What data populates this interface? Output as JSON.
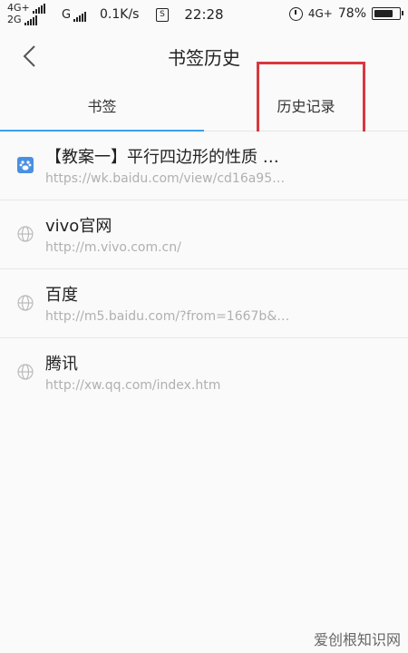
{
  "status_bar": {
    "net1": "4G+",
    "net2": "2G",
    "net3": "G",
    "speed": "0.1K/s",
    "time": "22:28",
    "net_right": "4G+",
    "battery": "78%",
    "battery_level": 0.78
  },
  "header": {
    "title": "书签历史"
  },
  "tabs": [
    {
      "label": "书签",
      "active": true
    },
    {
      "label": "历史记录",
      "active": false
    }
  ],
  "history": [
    {
      "title": "【教案一】平行四边形的性质 …",
      "url": "https://wk.baidu.com/view/cd16a95…",
      "icon": "baidu-icon"
    },
    {
      "title": "vivo官网",
      "url": "http://m.vivo.com.cn/",
      "icon": "globe-icon"
    },
    {
      "title": "百度",
      "url": "http://m5.baidu.com/?from=1667b&…",
      "icon": "globe-icon"
    },
    {
      "title": "腾讯",
      "url": "http://xw.qq.com/index.htm",
      "icon": "globe-icon"
    }
  ],
  "watermark": "爱创根知识网",
  "colors": {
    "accent": "#3aa0f0",
    "highlight": "#d9383e"
  }
}
